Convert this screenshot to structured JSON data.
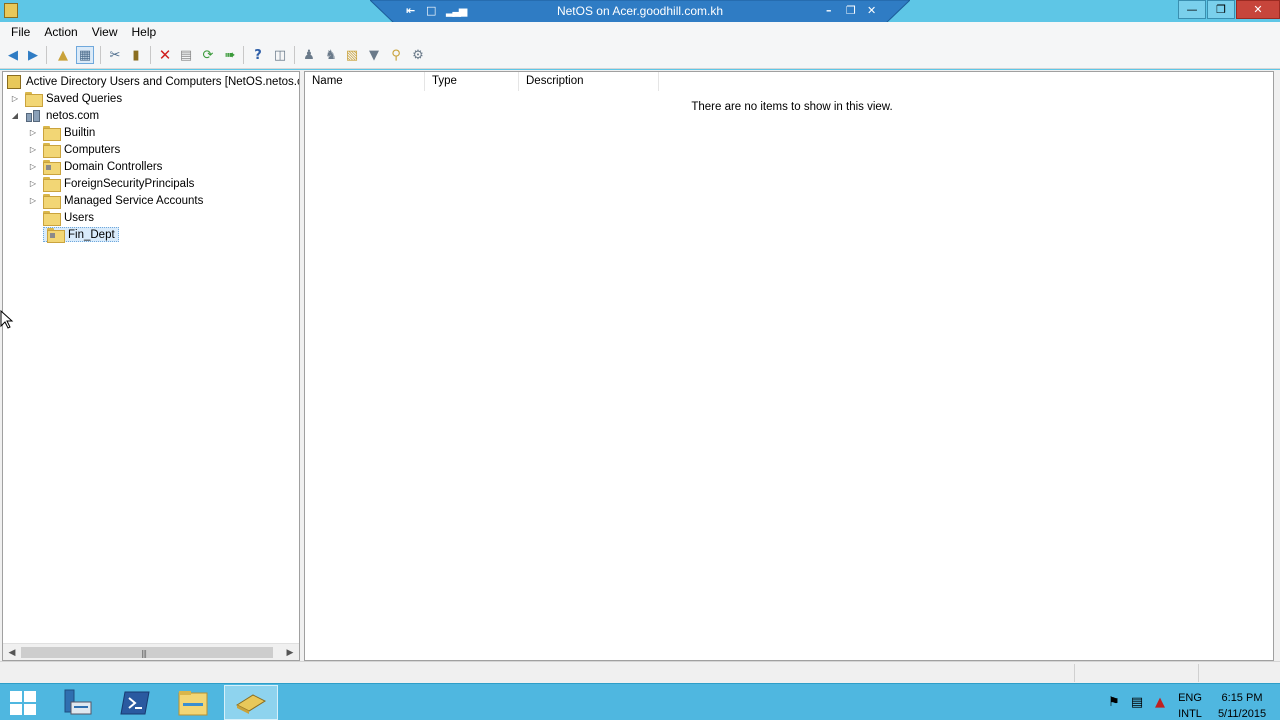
{
  "rdp": {
    "title": "NetOS on Acer.goodhill.com.kh"
  },
  "menu": [
    "File",
    "Action",
    "View",
    "Help"
  ],
  "tree": {
    "root": "Active Directory Users and Computers [NetOS.netos.com]",
    "saved_queries": "Saved Queries",
    "domain": "netos.com",
    "children": [
      "Builtin",
      "Computers",
      "Domain Controllers",
      "ForeignSecurityPrincipals",
      "Managed Service Accounts",
      "Users"
    ],
    "selected": "Fin_Dept"
  },
  "list": {
    "columns": [
      "Name",
      "Type",
      "Description"
    ],
    "empty_message": "There are no items to show in this view."
  },
  "tray": {
    "lang_top": "ENG",
    "lang_bottom": "INTL",
    "time": "6:15 PM",
    "date": "5/11/2015"
  },
  "colors": {
    "accent": "#5ec6e6",
    "taskbar": "#4fb7e0",
    "close": "#c7453b",
    "rdp_bar": "#2f7cc4"
  }
}
